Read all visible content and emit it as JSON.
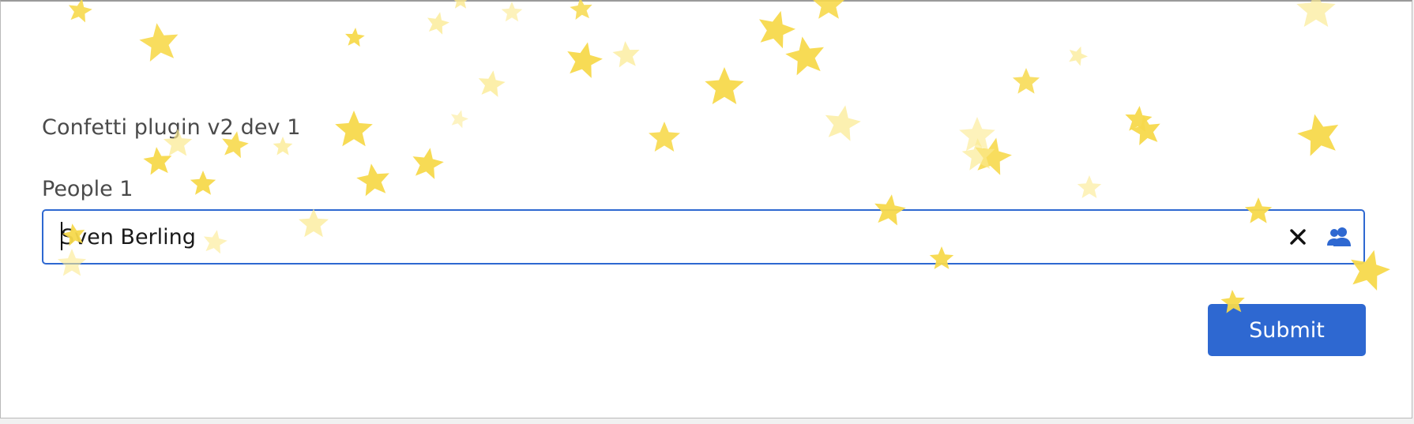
{
  "form": {
    "title": "Confetti plugin v2 dev 1",
    "people_label": "People 1",
    "people_value": "Sven Berling",
    "clear_icon": "close-icon",
    "picker_icon": "people-icon",
    "submit_label": "Submit"
  },
  "colors": {
    "accent": "#2e68d1",
    "star_bright": "#f7d94c",
    "star_pale": "#fbe98e"
  },
  "icons": {
    "confetti": "star-icon"
  }
}
